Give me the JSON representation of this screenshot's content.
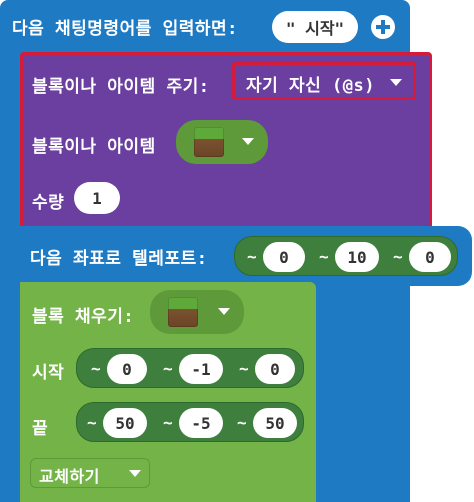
{
  "chat": {
    "label": "다음 채팅명령어를 입력하면:",
    "command": "\" 시작\""
  },
  "give": {
    "label": "블록이나 아이템 주기:",
    "target": "자기 자신 (@s)",
    "item_label": "블록이나 아이템",
    "item_icon": "grass-block-icon",
    "amount_label": "수량",
    "amount": "1"
  },
  "teleport": {
    "label": "다음 좌표로 텔레포트:",
    "x": "0",
    "y": "10",
    "z": "0"
  },
  "fill": {
    "label": "블록 채우기:",
    "block_icon": "grass-block-icon",
    "start_label": "시작",
    "start": {
      "x": "0",
      "y": "-1",
      "z": "0"
    },
    "end_label": "끝",
    "end": {
      "x": "50",
      "y": "-5",
      "z": "50"
    },
    "mode": "교체하기"
  },
  "glyphs": {
    "tilde": "~"
  },
  "colors": {
    "event_blue": "#1f7ac4",
    "give_purple": "#6a3fa0",
    "fill_green": "#74b348",
    "highlight_red": "#d51a3a"
  }
}
